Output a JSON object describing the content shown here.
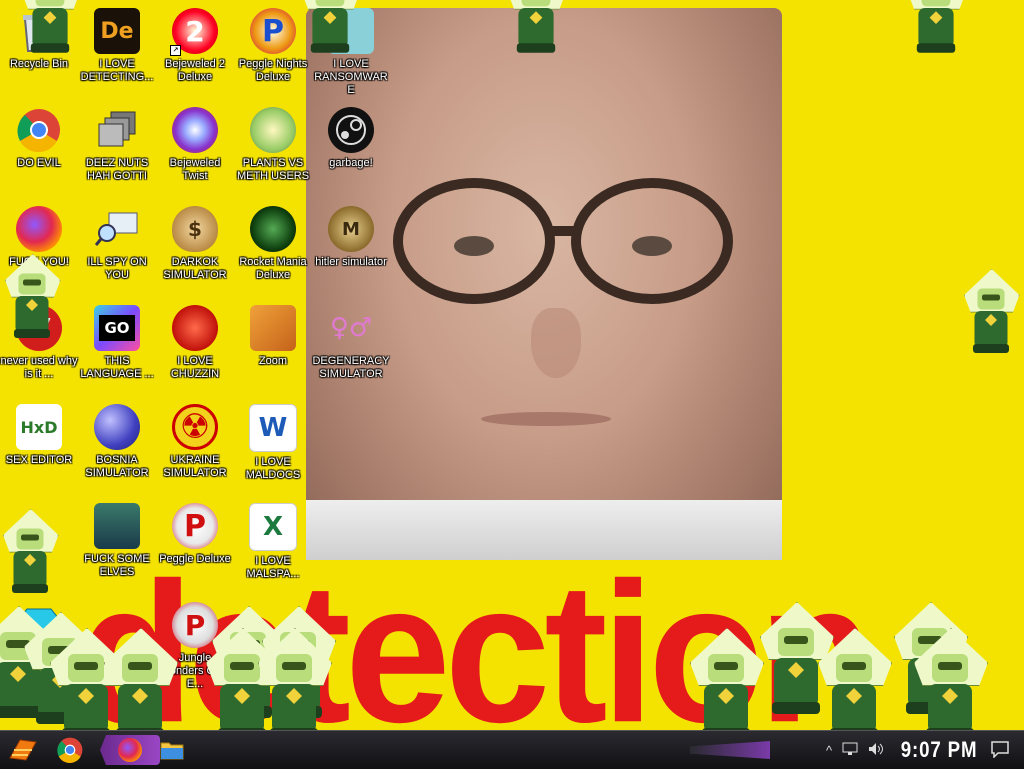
{
  "wallpaper": {
    "text": "detection",
    "colors": {
      "background": "#f4e300",
      "text": "#e51a1a"
    }
  },
  "desktop_icons": [
    {
      "label": "Recycle Bin",
      "icon": "recycle-bin-icon"
    },
    {
      "label": "I LOVE DETECTING...",
      "icon": "de-app-icon",
      "glyph": "De"
    },
    {
      "label": "Bejeweled 2 Deluxe",
      "icon": "bejeweled-2-icon",
      "glyph": "2"
    },
    {
      "label": "Peggle Nights Deluxe",
      "icon": "peggle-nights-icon",
      "glyph": "P"
    },
    {
      "label": "I LOVE RANSOMWARE",
      "icon": "ransomware-icon"
    },
    {
      "label": "DO EVIL",
      "icon": "chrome-icon"
    },
    {
      "label": "DEEZ NUTS HAH GOTTI",
      "icon": "windows-stack-icon"
    },
    {
      "label": "Bejeweled Twist",
      "icon": "bejeweled-twist-icon"
    },
    {
      "label": "PLANTS VS METH USERS",
      "icon": "plants-vs-zombies-icon"
    },
    {
      "label": "garbage!",
      "icon": "steam-icon"
    },
    {
      "label": "FUCK YOU!",
      "icon": "firefox-icon"
    },
    {
      "label": "ILL SPY ON YOU",
      "icon": "spy-monitor-icon"
    },
    {
      "label": "DARKOK SIMULATOR",
      "icon": "money-bag-icon",
      "glyph": "$"
    },
    {
      "label": "Rocket Mania Deluxe",
      "icon": "rocket-mania-icon"
    },
    {
      "label": "hitler simulator",
      "icon": "coin-icon",
      "glyph": "M"
    },
    {
      "label": "never used why is it ...",
      "icon": "dev-cpp-icon",
      "glyph": "DEV C++"
    },
    {
      "label": "THIS LANGUAGE ...",
      "icon": "goland-icon",
      "glyph": "GO"
    },
    {
      "label": "I LOVE CHUZZIN",
      "icon": "chuzzle-icon"
    },
    {
      "label": "Zoom",
      "icon": "zoom-icon"
    },
    {
      "label": "DEGENERACY SIMULATOR",
      "icon": "degeneracy-icon",
      "glyph": "♀♂"
    },
    {
      "label": "SEX EDITOR",
      "icon": "hxd-icon",
      "glyph": "HxD"
    },
    {
      "label": "BOSNIA SIMULATOR",
      "icon": "mine-icon"
    },
    {
      "label": "UKRAINE SIMULATOR",
      "icon": "radiation-icon",
      "glyph": "☢"
    },
    {
      "label": "I LOVE MALDOCS",
      "icon": "word-icon",
      "glyph": "W"
    },
    {
      "label": "FUCK SOME ELVES",
      "icon": "elf-icon"
    },
    {
      "label": "Peggle Deluxe",
      "icon": "peggle-deluxe-icon",
      "glyph": "P"
    },
    {
      "label": "I LOVE MALSPA...",
      "icon": "excel-icon",
      "glyph": "X"
    },
    {
      "label": "Jungle Wonders Craft E...",
      "icon": "jungle-icon",
      "glyph": "P"
    }
  ],
  "taskbar": {
    "clock": "9:07 PM",
    "apps": [
      {
        "name": "start",
        "icon": "start-icon"
      },
      {
        "name": "chrome",
        "icon": "chrome-icon"
      },
      {
        "name": "firefox",
        "icon": "firefox-icon"
      },
      {
        "name": "file-explorer",
        "icon": "folder-icon"
      }
    ],
    "tray": {
      "chevron": "^",
      "network": "network-icon",
      "volume": "volume-icon",
      "notifications": "notification-icon"
    }
  }
}
